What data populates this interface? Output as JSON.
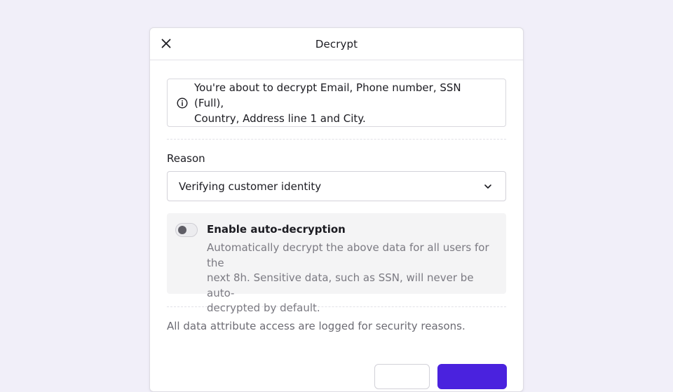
{
  "dialog": {
    "title": "Decrypt"
  },
  "info": {
    "line1": "You're about to decrypt Email, Phone number, SSN (Full),",
    "line2": "Country, Address line 1 and City.",
    "icon": "info-icon"
  },
  "reason": {
    "label": "Reason",
    "selected": "Verifying customer identity"
  },
  "auto_decryption": {
    "title": "Enable auto-decryption",
    "description_line1": "Automatically decrypt the above data for all users for the",
    "description_line2": "next 8h. Sensitive data, such as SSN, will never be auto-",
    "description_line3": "decrypted by default.",
    "enabled": false
  },
  "footer": {
    "note": "All data attribute access are logged for security reasons."
  },
  "colors": {
    "background": "#f1eff9",
    "primary": "#4a22de",
    "muted_text": "#7b7a82"
  }
}
